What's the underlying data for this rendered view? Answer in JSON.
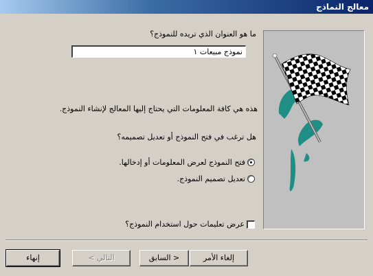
{
  "window": {
    "title": "معالج النماذج"
  },
  "form": {
    "title_question": "ما هو العنوان الذي تريده للنموذج؟",
    "title_value": "نموذج مبيعات ١",
    "info_text": "هذه هي كافة المعلومات التي يحتاج إليها المعالج لإنشاء النموذج.",
    "open_question": "هل ترغب في فتح النموذج أو تعديل تصميمه؟",
    "options": [
      {
        "label": "فتح النموذج لعرض المعلومات أو إدخالها.",
        "selected": true
      },
      {
        "label": "تعديل تصميم النموذج.",
        "selected": false
      }
    ],
    "help_checkbox": {
      "label": "عرض تعليمات حول استخدام النموذج؟",
      "checked": false
    }
  },
  "buttons": {
    "cancel": "إلغاء الأمر",
    "back": "< السابق",
    "next": "التالي >",
    "finish": "إنهاء"
  },
  "picture": {
    "icon": "checkered-flag-icon"
  },
  "colors": {
    "titlebar": "#0a246a",
    "dialog_bg": "#d4d0c8",
    "picture_bg": "#c0c0c0",
    "teal_splash": "#1f8f86"
  }
}
